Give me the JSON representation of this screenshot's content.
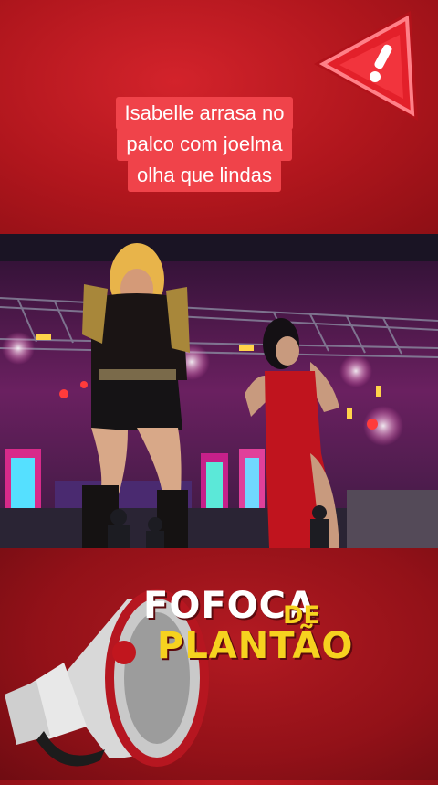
{
  "caption": {
    "lines": [
      "Isabelle arrasa no",
      "palco com joelma",
      "olha que lindas"
    ]
  },
  "brand": {
    "line1": "FOFOCA",
    "line1_suffix": "DE",
    "line2": "PLANTÃO"
  },
  "icons": {
    "warning": "warning-icon",
    "megaphone": "megaphone-icon"
  },
  "colors": {
    "background": "#a5131b",
    "caption_bg": "#f0434a",
    "brand_white": "#ffffff",
    "brand_yellow": "#f6d21f",
    "warning_red": "#e3202a"
  }
}
